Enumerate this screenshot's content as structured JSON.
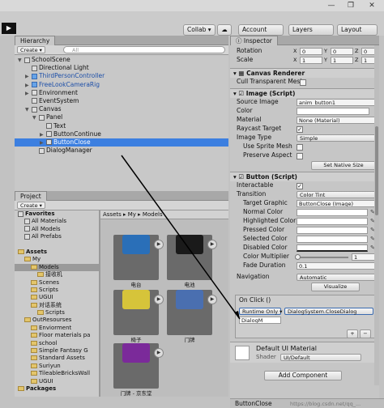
{
  "window_controls": {
    "minimize": "—",
    "maximize": "❐",
    "close": "✕"
  },
  "toolbar": {
    "play": "▶",
    "collab": "Collab ▾",
    "cloud": "☁",
    "account": "Account",
    "layers": "Layers",
    "layout": "Layout"
  },
  "hierarchy": {
    "tab": "Hierarchy",
    "create": "Create ▾",
    "search_placeholder": "All",
    "items": [
      {
        "label": "SchoolScene",
        "depth": 0,
        "arrow": "▼",
        "selected": false
      },
      {
        "label": "Directional Light",
        "depth": 1,
        "arrow": "",
        "selected": false
      },
      {
        "label": "ThirdPersonController",
        "depth": 1,
        "arrow": "▶",
        "selected": false,
        "prefab": true
      },
      {
        "label": "FreeLookCameraRig",
        "depth": 1,
        "arrow": "▶",
        "selected": false,
        "prefab": true
      },
      {
        "label": "Environment",
        "depth": 1,
        "arrow": "▶",
        "selected": false
      },
      {
        "label": "EventSystem",
        "depth": 1,
        "arrow": "",
        "selected": false
      },
      {
        "label": "Canvas",
        "depth": 1,
        "arrow": "▼",
        "selected": false
      },
      {
        "label": "Panel",
        "depth": 2,
        "arrow": "▼",
        "selected": false
      },
      {
        "label": "Text",
        "depth": 3,
        "arrow": "",
        "selected": false
      },
      {
        "label": "ButtonContinue",
        "depth": 3,
        "arrow": "▶",
        "selected": false
      },
      {
        "label": "ButtonClose",
        "depth": 3,
        "arrow": "▶",
        "selected": true
      },
      {
        "label": "DialogManager",
        "depth": 2,
        "arrow": "",
        "selected": false
      }
    ]
  },
  "project": {
    "tab": "Project",
    "create": "Create ▾",
    "breadcrumb": [
      "Assets ▸",
      "My ▸",
      "Models"
    ],
    "tree": [
      {
        "label": "Favorites",
        "depth": 0,
        "bold": true,
        "folder": false
      },
      {
        "label": "All Materials",
        "depth": 1,
        "bold": false,
        "folder": false
      },
      {
        "label": "All Models",
        "depth": 1,
        "bold": false,
        "folder": false
      },
      {
        "label": "All Prefabs",
        "depth": 1,
        "bold": false,
        "folder": false
      },
      {
        "label": "",
        "depth": 0,
        "bold": false,
        "folder": false
      },
      {
        "label": "Assets",
        "depth": 0,
        "bold": true,
        "folder": true
      },
      {
        "label": "My",
        "depth": 1,
        "bold": false,
        "folder": true
      },
      {
        "label": "Models",
        "depth": 2,
        "bold": false,
        "folder": true,
        "selected": true
      },
      {
        "label": "接收机",
        "depth": 3,
        "bold": false,
        "folder": true
      },
      {
        "label": "Scenes",
        "depth": 2,
        "bold": false,
        "folder": true
      },
      {
        "label": "Scripts",
        "depth": 2,
        "bold": false,
        "folder": true
      },
      {
        "label": "UGUI",
        "depth": 2,
        "bold": false,
        "folder": true
      },
      {
        "label": "对话系统",
        "depth": 2,
        "bold": false,
        "folder": true
      },
      {
        "label": "Scripts",
        "depth": 3,
        "bold": false,
        "folder": true
      },
      {
        "label": "OutResourses",
        "depth": 1,
        "bold": false,
        "folder": true
      },
      {
        "label": "Enviorment",
        "depth": 2,
        "bold": false,
        "folder": true
      },
      {
        "label": "Floor materials pa",
        "depth": 2,
        "bold": false,
        "folder": true
      },
      {
        "label": "school",
        "depth": 2,
        "bold": false,
        "folder": true
      },
      {
        "label": "Simple Fantasy G",
        "depth": 2,
        "bold": false,
        "folder": true
      },
      {
        "label": "Standard Assets",
        "depth": 2,
        "bold": false,
        "folder": true
      },
      {
        "label": "Suriyun",
        "depth": 2,
        "bold": false,
        "folder": true
      },
      {
        "label": "TileableBricksWall",
        "depth": 2,
        "bold": false,
        "folder": true
      },
      {
        "label": "UGUI",
        "depth": 2,
        "bold": false,
        "folder": true
      },
      {
        "label": "Packages",
        "depth": 0,
        "bold": true,
        "folder": true
      }
    ],
    "assets": [
      {
        "label": "电台",
        "thumb": "#2a6fb8"
      },
      {
        "label": "电池",
        "thumb": "#1a1a1a"
      },
      {
        "label": "椅子",
        "thumb": "#d6c43a"
      },
      {
        "label": "门牌",
        "thumb": "#4a6fb0"
      },
      {
        "label": "门牌 - 京东堂",
        "thumb": "#7b2a9a"
      }
    ]
  },
  "inspector": {
    "tab": "Inspector",
    "rect": {
      "rotation_label": "Rotation",
      "scale_label": "Scale",
      "rx": "0",
      "ry": "0",
      "rz": "0",
      "sx": "1",
      "sy": "1",
      "sz": "1"
    },
    "canvas_renderer": {
      "title": "Canvas Renderer",
      "cull_label": "Cull Transparent Mesh"
    },
    "image": {
      "title": "Image (Script)",
      "source_image_label": "Source Image",
      "source_image": "anim_button1",
      "color_label": "Color",
      "material_label": "Material",
      "material": "None (Material)",
      "raycast_label": "Raycast Target",
      "image_type_label": "Image Type",
      "image_type": "Simple",
      "sprite_mesh_label": "Use Sprite Mesh",
      "preserve_label": "Preserve Aspect",
      "native_button": "Set Native Size"
    },
    "button": {
      "title": "Button (Script)",
      "interactable_label": "Interactable",
      "transition_label": "Transition",
      "transition": "Color Tint",
      "target_graphic_label": "Target Graphic",
      "target_graphic": "ButtonClose (Image)",
      "normal_label": "Normal Color",
      "highlighted_label": "Highlighted Color",
      "pressed_label": "Pressed Color",
      "selected_label": "Selected Color",
      "disabled_label": "Disabled Color",
      "multiplier_label": "Color Multiplier",
      "multiplier": "1",
      "fade_label": "Fade Duration",
      "fade": "0.1",
      "navigation_label": "Navigation",
      "navigation": "Automatic",
      "visualize_button": "Visualize",
      "onclick_label": "On Click ()",
      "runtime": "Runtime Only ▾",
      "function": "DialogSystem.CloseDialog",
      "object": "DialogM",
      "plus": "+",
      "minus": "−"
    },
    "material": {
      "title": "Default UI Material",
      "shader_label": "Shader",
      "shader": "UI/Default"
    },
    "add_component": "Add Component"
  },
  "status_bar": {
    "selection": "ButtonClose",
    "watermark": "https://blog.csdn.net/qq_..."
  }
}
